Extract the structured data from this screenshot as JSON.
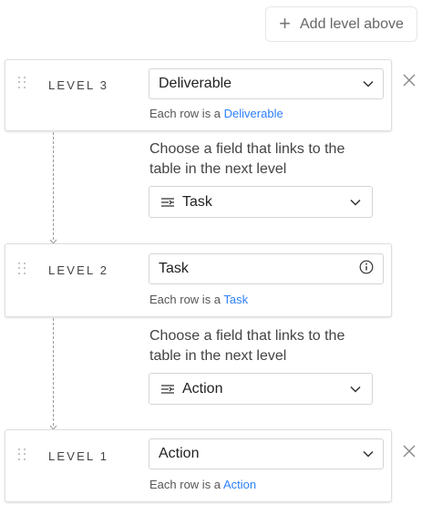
{
  "header": {
    "add_level_label": "Add level above"
  },
  "levels": [
    {
      "label": "LEVEL 3",
      "table": "Deliverable",
      "row_prefix": "Each row is a ",
      "row_link": "Deliverable"
    },
    {
      "label": "LEVEL 2",
      "table": "Task",
      "row_prefix": "Each row is a ",
      "row_link": "Task"
    },
    {
      "label": "LEVEL 1",
      "table": "Action",
      "row_prefix": "Each row is a ",
      "row_link": "Action"
    }
  ],
  "links": [
    {
      "line1": "Choose a field that links to the",
      "line2": "table in the next level",
      "field": "Task"
    },
    {
      "line1": "Choose a field that links to the",
      "line2": "table in the next level",
      "field": "Action"
    }
  ],
  "colors": {
    "link_blue": "#2d7ff9",
    "border": "#dedede"
  }
}
